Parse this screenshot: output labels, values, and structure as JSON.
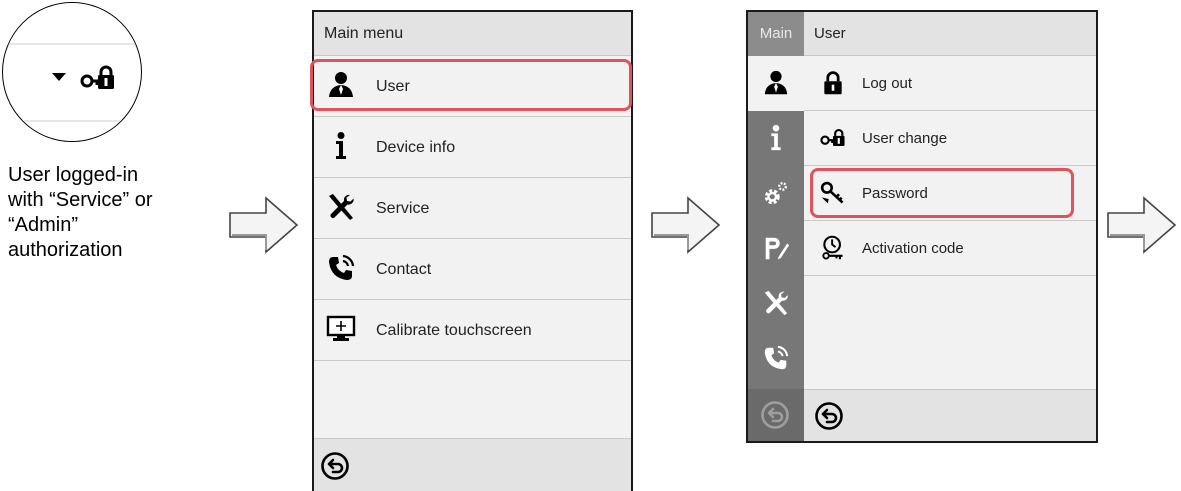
{
  "caption": {
    "line1": "User logged-in",
    "line2": "with “Service” or",
    "line3": "“Admin”",
    "line4": "authorization"
  },
  "zoom_icons": [
    "dropdown-triangle-icon",
    "key-lock-icon"
  ],
  "main_menu": {
    "title": "Main menu",
    "items": [
      {
        "label": "User",
        "icon": "user-icon",
        "highlighted": true
      },
      {
        "label": "Device info",
        "icon": "info-icon"
      },
      {
        "label": "Service",
        "icon": "tools-icon"
      },
      {
        "label": "Contact",
        "icon": "phone-icon"
      },
      {
        "label": "Calibrate touchscreen",
        "icon": "monitor-icon"
      }
    ],
    "footer_icon": "back-icon"
  },
  "user_menu": {
    "sidebar_title": "Main",
    "title": "User",
    "sidebar_icons": [
      "user-icon",
      "info-icon",
      "settings-icon",
      "program-icon",
      "tools-icon",
      "phone-icon"
    ],
    "items": [
      {
        "label": "Log out",
        "icon": "lock-icon"
      },
      {
        "label": "User change",
        "icon": "key-lock-icon"
      },
      {
        "label": "Password",
        "icon": "key-icon",
        "highlighted": true
      },
      {
        "label": "Activation code",
        "icon": "activation-key-icon"
      }
    ],
    "footer_icon": "back-icon"
  },
  "colors": {
    "highlight": "#e0525c",
    "sidebar": "#777777",
    "panel_bg": "#f2f2f2",
    "header_bg": "#e3e3e3"
  }
}
